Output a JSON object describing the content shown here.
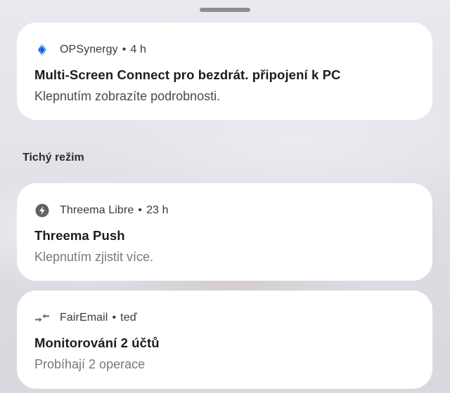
{
  "panel": {
    "handle_icon": "drag-handle"
  },
  "notifications_top": [
    {
      "icon": "opsynergy-icon",
      "icon_color": "#1a73e8",
      "app": "OPSynergy",
      "separator": "•",
      "time": "4 h",
      "title": "Multi-Screen Connect pro bezdrát. připojení k PC",
      "text": "Klepnutím zobrazíte podrobnosti."
    }
  ],
  "silent_section": {
    "label": "Tichý režim"
  },
  "notifications_silent": [
    {
      "icon": "bolt-icon",
      "icon_color": "#5f6368",
      "app": "Threema Libre",
      "separator": "•",
      "time": "23 h",
      "title": "Threema Push",
      "text": "Klepnutím zjistit více."
    },
    {
      "icon": "sync-arrows-icon",
      "icon_color": "#5f6368",
      "app": "FairEmail",
      "separator": "•",
      "time": "teď",
      "title": "Monitorování 2 účtů",
      "text": "Probíhají 2 operace"
    }
  ]
}
